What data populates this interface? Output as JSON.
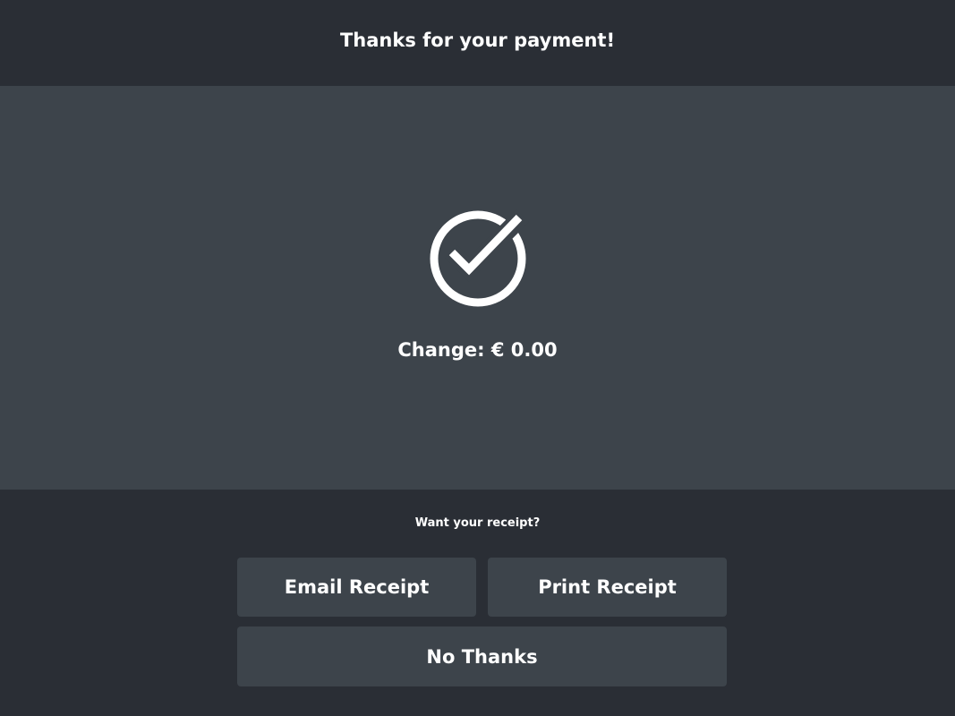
{
  "header": {
    "title": "Thanks for your payment!"
  },
  "main": {
    "status_icon": "check-circle-icon",
    "change_text": "Change: € 0.00"
  },
  "receipt": {
    "question": "Want your receipt?",
    "email_label": "Email Receipt",
    "print_label": "Print Receipt",
    "no_thanks_label": "No Thanks"
  },
  "colors": {
    "dark_background": "#2a2e35",
    "panel_background": "#3d444b",
    "text": "#ffffff"
  }
}
